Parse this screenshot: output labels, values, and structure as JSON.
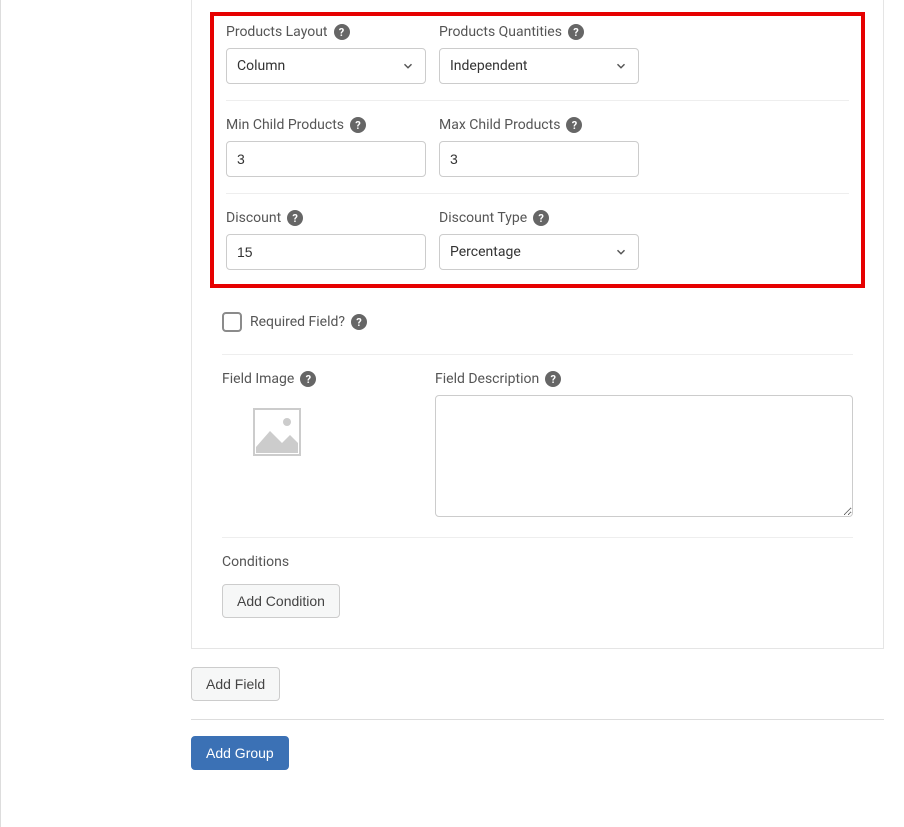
{
  "fields": {
    "products_layout": {
      "label": "Products Layout",
      "value": "Column"
    },
    "products_quantities": {
      "label": "Products Quantities",
      "value": "Independent"
    },
    "min_child_products": {
      "label": "Min Child Products",
      "value": "3"
    },
    "max_child_products": {
      "label": "Max Child Products",
      "value": "3"
    },
    "discount": {
      "label": "Discount",
      "value": "15"
    },
    "discount_type": {
      "label": "Discount Type",
      "value": "Percentage"
    },
    "required_field": {
      "label": "Required Field?"
    },
    "field_image": {
      "label": "Field Image"
    },
    "field_description": {
      "label": "Field Description",
      "value": ""
    },
    "conditions": {
      "label": "Conditions"
    }
  },
  "buttons": {
    "add_condition": "Add Condition",
    "add_field": "Add Field",
    "add_group": "Add Group"
  },
  "icons": {
    "help_glyph": "?"
  }
}
